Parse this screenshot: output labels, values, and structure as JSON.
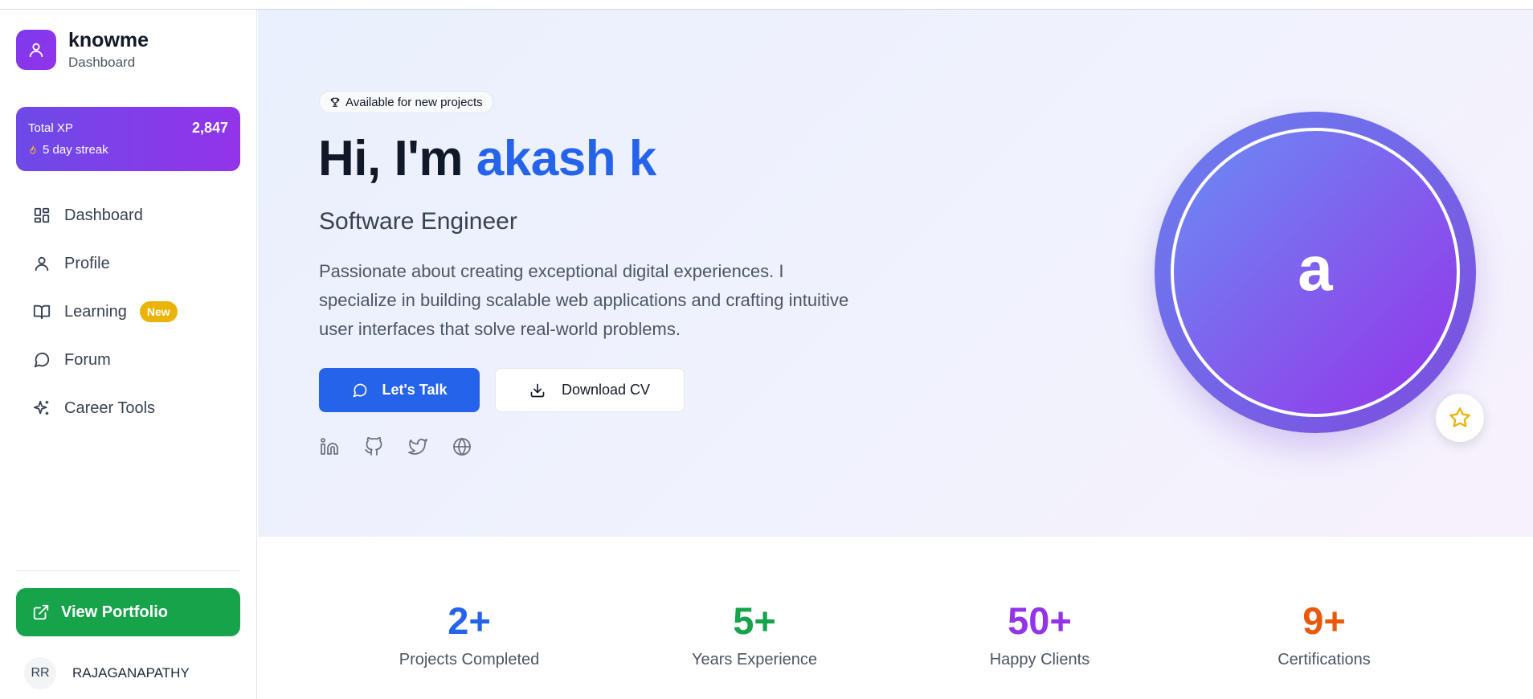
{
  "brand": {
    "name": "knowme",
    "subtitle": "Dashboard"
  },
  "xp": {
    "label": "Total XP",
    "value": "2,847",
    "streak": "5 day streak"
  },
  "nav": [
    {
      "label": "Dashboard",
      "icon": "grid-icon"
    },
    {
      "label": "Profile",
      "icon": "user-icon"
    },
    {
      "label": "Learning",
      "icon": "book-icon",
      "badge": "New"
    },
    {
      "label": "Forum",
      "icon": "chat-icon"
    },
    {
      "label": "Career Tools",
      "icon": "sparkles-icon"
    }
  ],
  "view_portfolio": "View Portfolio",
  "user": {
    "initials": "RR",
    "name": "RAJAGANAPATHY"
  },
  "hero": {
    "badge": "Available for new projects",
    "greeting": "Hi, I'm ",
    "name": "akash k",
    "role": "Software Engineer",
    "description": "Passionate about creating exceptional digital experiences. I specialize in building scalable web applications and crafting intuitive user interfaces that solve real-world problems.",
    "talk_button": "Let's Talk",
    "cv_button": "Download CV",
    "avatar_letter": "a",
    "socials": [
      "linkedin-icon",
      "github-icon",
      "twitter-icon",
      "globe-icon"
    ]
  },
  "stats": [
    {
      "value": "2+",
      "label": "Projects Completed",
      "color": "#2563eb"
    },
    {
      "value": "5+",
      "label": "Years Experience",
      "color": "#16a34a"
    },
    {
      "value": "50+",
      "label": "Happy Clients",
      "color": "#9333ea"
    },
    {
      "value": "9+",
      "label": "Certifications",
      "color": "#ea580c"
    }
  ],
  "colors": {
    "primary": "#2563eb",
    "accent_purple": "#7c3aed",
    "success": "#16a34a",
    "badge_yellow": "#eab308"
  }
}
